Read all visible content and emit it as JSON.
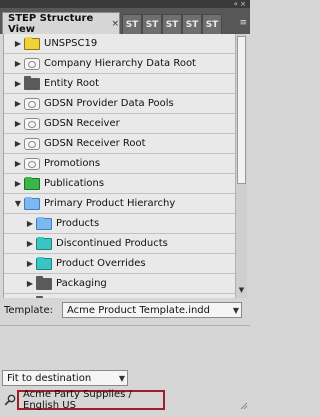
{
  "panel": {
    "active_tab": "STEP Structure View",
    "close_glyph": "×",
    "minimize_glyph": "«  ×",
    "other_tabs": [
      "ST",
      "ST",
      "ST",
      "ST",
      "ST"
    ],
    "menu_glyph": "≡"
  },
  "tree": {
    "nodes": [
      {
        "label": "UNSPSC19",
        "icon": "yellow-folder-icon",
        "expanded": false
      },
      {
        "label": "Company Hierarchy Data Root",
        "icon": "chip-icon",
        "expanded": false
      },
      {
        "label": "Entity Root",
        "icon": "dark-folder-icon",
        "expanded": false
      },
      {
        "label": "GDSN Provider Data Pools",
        "icon": "chip-icon",
        "expanded": false
      },
      {
        "label": "GDSN Receiver",
        "icon": "chip-icon",
        "expanded": false
      },
      {
        "label": "GDSN Receiver Root",
        "icon": "chip-icon",
        "expanded": false
      },
      {
        "label": "Promotions",
        "icon": "chip-icon",
        "expanded": false
      },
      {
        "label": "Publications",
        "icon": "green-folder-icon",
        "expanded": false
      },
      {
        "label": "Primary Product Hierarchy",
        "icon": "blue-folder-icon",
        "expanded": true
      },
      {
        "label": "Products",
        "icon": "blue-folder-icon",
        "expanded": false,
        "child": true
      },
      {
        "label": "Discontinued Products",
        "icon": "teal-folder-icon",
        "expanded": false,
        "child": true
      },
      {
        "label": "Product Overrides",
        "icon": "teal-folder-icon",
        "expanded": false,
        "child": true
      },
      {
        "label": "Packaging",
        "icon": "dark-folder-icon",
        "expanded": false,
        "child": true
      },
      {
        "label": "",
        "icon": "dark-folder-icon",
        "expanded": false,
        "child": true
      }
    ]
  },
  "template": {
    "label": "Template:",
    "value": "Acme Product Template.indd"
  },
  "fit": {
    "value": "Fit to destination"
  },
  "status": {
    "context": "Acme Party Supplies / English US"
  },
  "colors": {
    "tab_bar": "#575757",
    "panel_bg": "#d6d6d6",
    "highlight_border": "#a01c2a"
  }
}
